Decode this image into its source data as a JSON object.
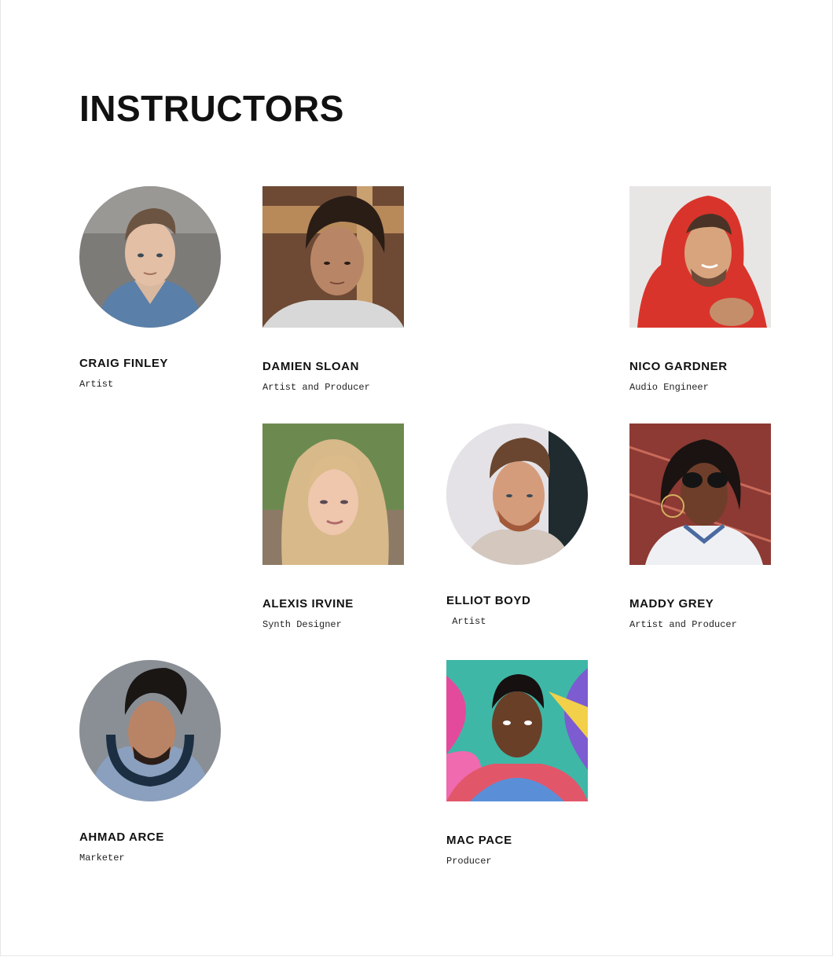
{
  "page": {
    "title": "INSTRUCTORS"
  },
  "instructors": [
    {
      "name": "CRAIG FINLEY",
      "role": "Artist",
      "shape": "circle"
    },
    {
      "name": "DAMIEN SLOAN",
      "role": "Artist and Producer",
      "shape": "square"
    },
    {
      "name": "NICO GARDNER",
      "role": "Audio Engineer",
      "shape": "square"
    },
    {
      "name": "ALEXIS IRVINE",
      "role": "Synth Designer",
      "shape": "square"
    },
    {
      "name": "ELLIOT BOYD",
      "role": " Artist",
      "shape": "circle"
    },
    {
      "name": "MADDY GREY",
      "role": "Artist and Producer",
      "shape": "square"
    },
    {
      "name": "AHMAD ARCE",
      "role": "Marketer",
      "shape": "circle"
    },
    {
      "name": "MAC PACE",
      "role": "Producer",
      "shape": "square"
    }
  ],
  "colors": {
    "text": "#111111",
    "background": "#ffffff"
  }
}
